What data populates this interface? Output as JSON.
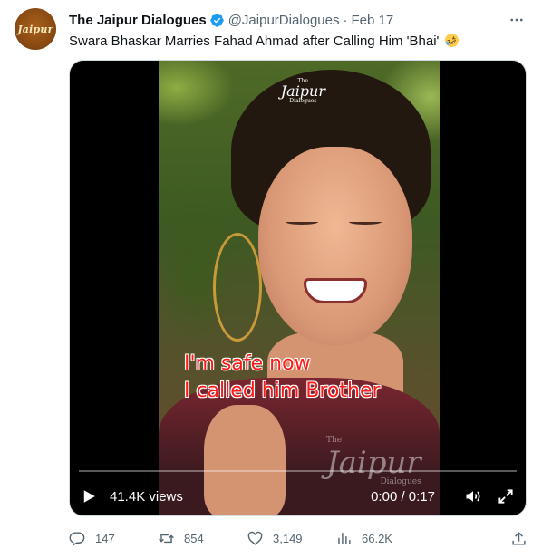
{
  "account": {
    "avatar_logo_text": "Jaipur",
    "display_name": "The Jaipur Dialogues",
    "handle": "@JaipurDialogues",
    "separator": "·",
    "date": "Feb 17",
    "verified": true
  },
  "tweet": {
    "text": "Swara Bhaskar Marries Fahad Ahmad after Calling Him 'Bhai'",
    "emoji": "rolling-on-floor-laughing"
  },
  "video": {
    "watermark_top": "Jaipur",
    "watermark_top_small": "The",
    "watermark_top_tiny": "Dialogues",
    "watermark_bottom": "Jaipur",
    "watermark_bottom_small": "The",
    "watermark_bottom_tiny": "Dialogues",
    "caption_line1": "I'm safe now",
    "caption_line2": "I called him Brother",
    "views": "41.4K views",
    "time": "0:00 / 0:17",
    "progress": 0
  },
  "actions": {
    "replies": "147",
    "retweets": "854",
    "likes": "3,149",
    "views": "66.2K"
  },
  "colors": {
    "verified": "#1d9bf0",
    "secondary_text": "#536471",
    "caption": "#ff1a1a"
  }
}
